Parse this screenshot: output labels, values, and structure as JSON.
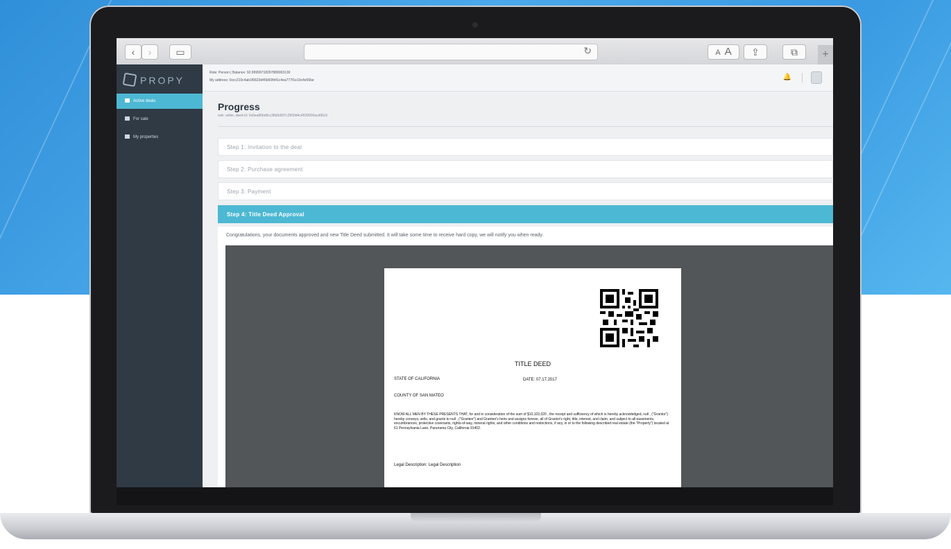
{
  "browser": {
    "back_icon": "chevron-left-icon",
    "forward_icon": "chevron-right-icon",
    "sidebar_icon": "sidebar-toggle-icon",
    "reload_glyph": "↻",
    "font_small": "A",
    "font_large": "A",
    "share_glyph": "⇪",
    "tabs_glyph": "⧉",
    "new_tab_glyph": "+"
  },
  "app": {
    "logo": "PROPY",
    "nav": [
      {
        "label": "Active deals",
        "active": true
      },
      {
        "label": "For sale",
        "active": false
      },
      {
        "label": "My properties",
        "active": false
      }
    ],
    "header": {
      "line1": "Role: Person | Balance: 92.99999718297889003130",
      "line2": "My address: 0xcc210c4ab1f6823d45b50fd41c4ea777f1e10c4e55be",
      "bell_glyph": "🔔"
    }
  },
  "main": {
    "title": "Progress",
    "subtitle": "role: seller, deed id: 0x6ea80bd9cc3fb6b907c2809d4c4539600acd96c5",
    "steps": [
      {
        "label": "Step 1: Invitation to the deal",
        "active": false
      },
      {
        "label": "Step 2: Purchase agreement",
        "active": false
      },
      {
        "label": "Step 3: Payment",
        "active": false
      },
      {
        "label": "Step 4: Title Deed Approval",
        "active": true
      }
    ],
    "congrats": "Congratulations, your documents approved and new Title Deed submitted. It will take some time to receive hard copy, we will notify you when ready."
  },
  "deed": {
    "title": "TITLE DEED",
    "state": "STATE OF CALIFORNIA",
    "date": "DATE: 07.17.2017",
    "county": "COUNTY OF SAN MATEO",
    "body": "KNOW ALL MEN BY THESE PRESENTS THAT, for and in consideration of the sum of $10,102,020 , the receipt and sufficiency of which is hereby acknowledged, null , (\"Grantor\") hereby conveys, sells, and grants to null , (\"Grantee\") and Grantee's heirs and assigns forever, all of Grantor's right, title, interest, and claim, and subject to all easements, encumbrances, protective covenants, rights-of-way, mineral rights, and other conditions and restrictions, if any, in or to the following described real estate (the \"Property\") located at 61 Pennsylvania Lane, Panorama City, California 91402.",
    "legal": "Legal Description: Legal Description"
  },
  "colors": {
    "accent": "#4db8d3",
    "sidebar": "#2f3a45",
    "viewer": "#525659"
  }
}
